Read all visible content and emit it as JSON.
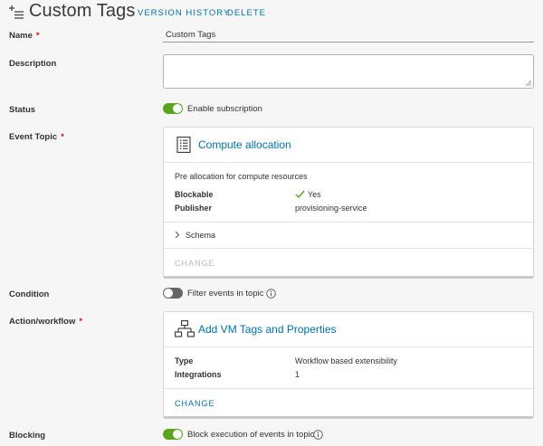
{
  "header": {
    "title": "Custom Tags",
    "version_history": "VERSION HISTORY",
    "delete": "DELETE"
  },
  "name": {
    "label": "Name",
    "required_mark": "*",
    "value": "Custom Tags"
  },
  "description": {
    "label": "Description",
    "value": ""
  },
  "status": {
    "label": "Status",
    "toggle_on": true,
    "toggle_label": "Enable subscription"
  },
  "event_topic": {
    "label": "Event Topic",
    "required_mark": "*",
    "card": {
      "icon": "document-list-icon",
      "title": "Compute allocation",
      "description": "Pre allocation for compute resources",
      "blockable_label": "Blockable",
      "blockable_value": "Yes",
      "publisher_label": "Publisher",
      "publisher_value": "provisioning-service",
      "schema_label": "Schema",
      "change_label": "CHANGE"
    }
  },
  "condition": {
    "label": "Condition",
    "toggle_on": false,
    "toggle_label": "Filter events in topic"
  },
  "action_workflow": {
    "label": "Action/workflow",
    "required_mark": "*",
    "card": {
      "icon": "workflow-icon",
      "title": "Add VM Tags and Properties",
      "type_label": "Type",
      "type_value": "Workflow based extensibility",
      "integrations_label": "Integrations",
      "integrations_value": "1",
      "change_label": "CHANGE"
    }
  },
  "blocking": {
    "label": "Blocking",
    "toggle_on": true,
    "toggle_label": "Block execution of events in topic"
  },
  "colors": {
    "link": "#0072a3",
    "toggle_on": "#5aa220",
    "toggle_off": "#666666",
    "required": "#c21d00",
    "check": "#5aa220"
  }
}
